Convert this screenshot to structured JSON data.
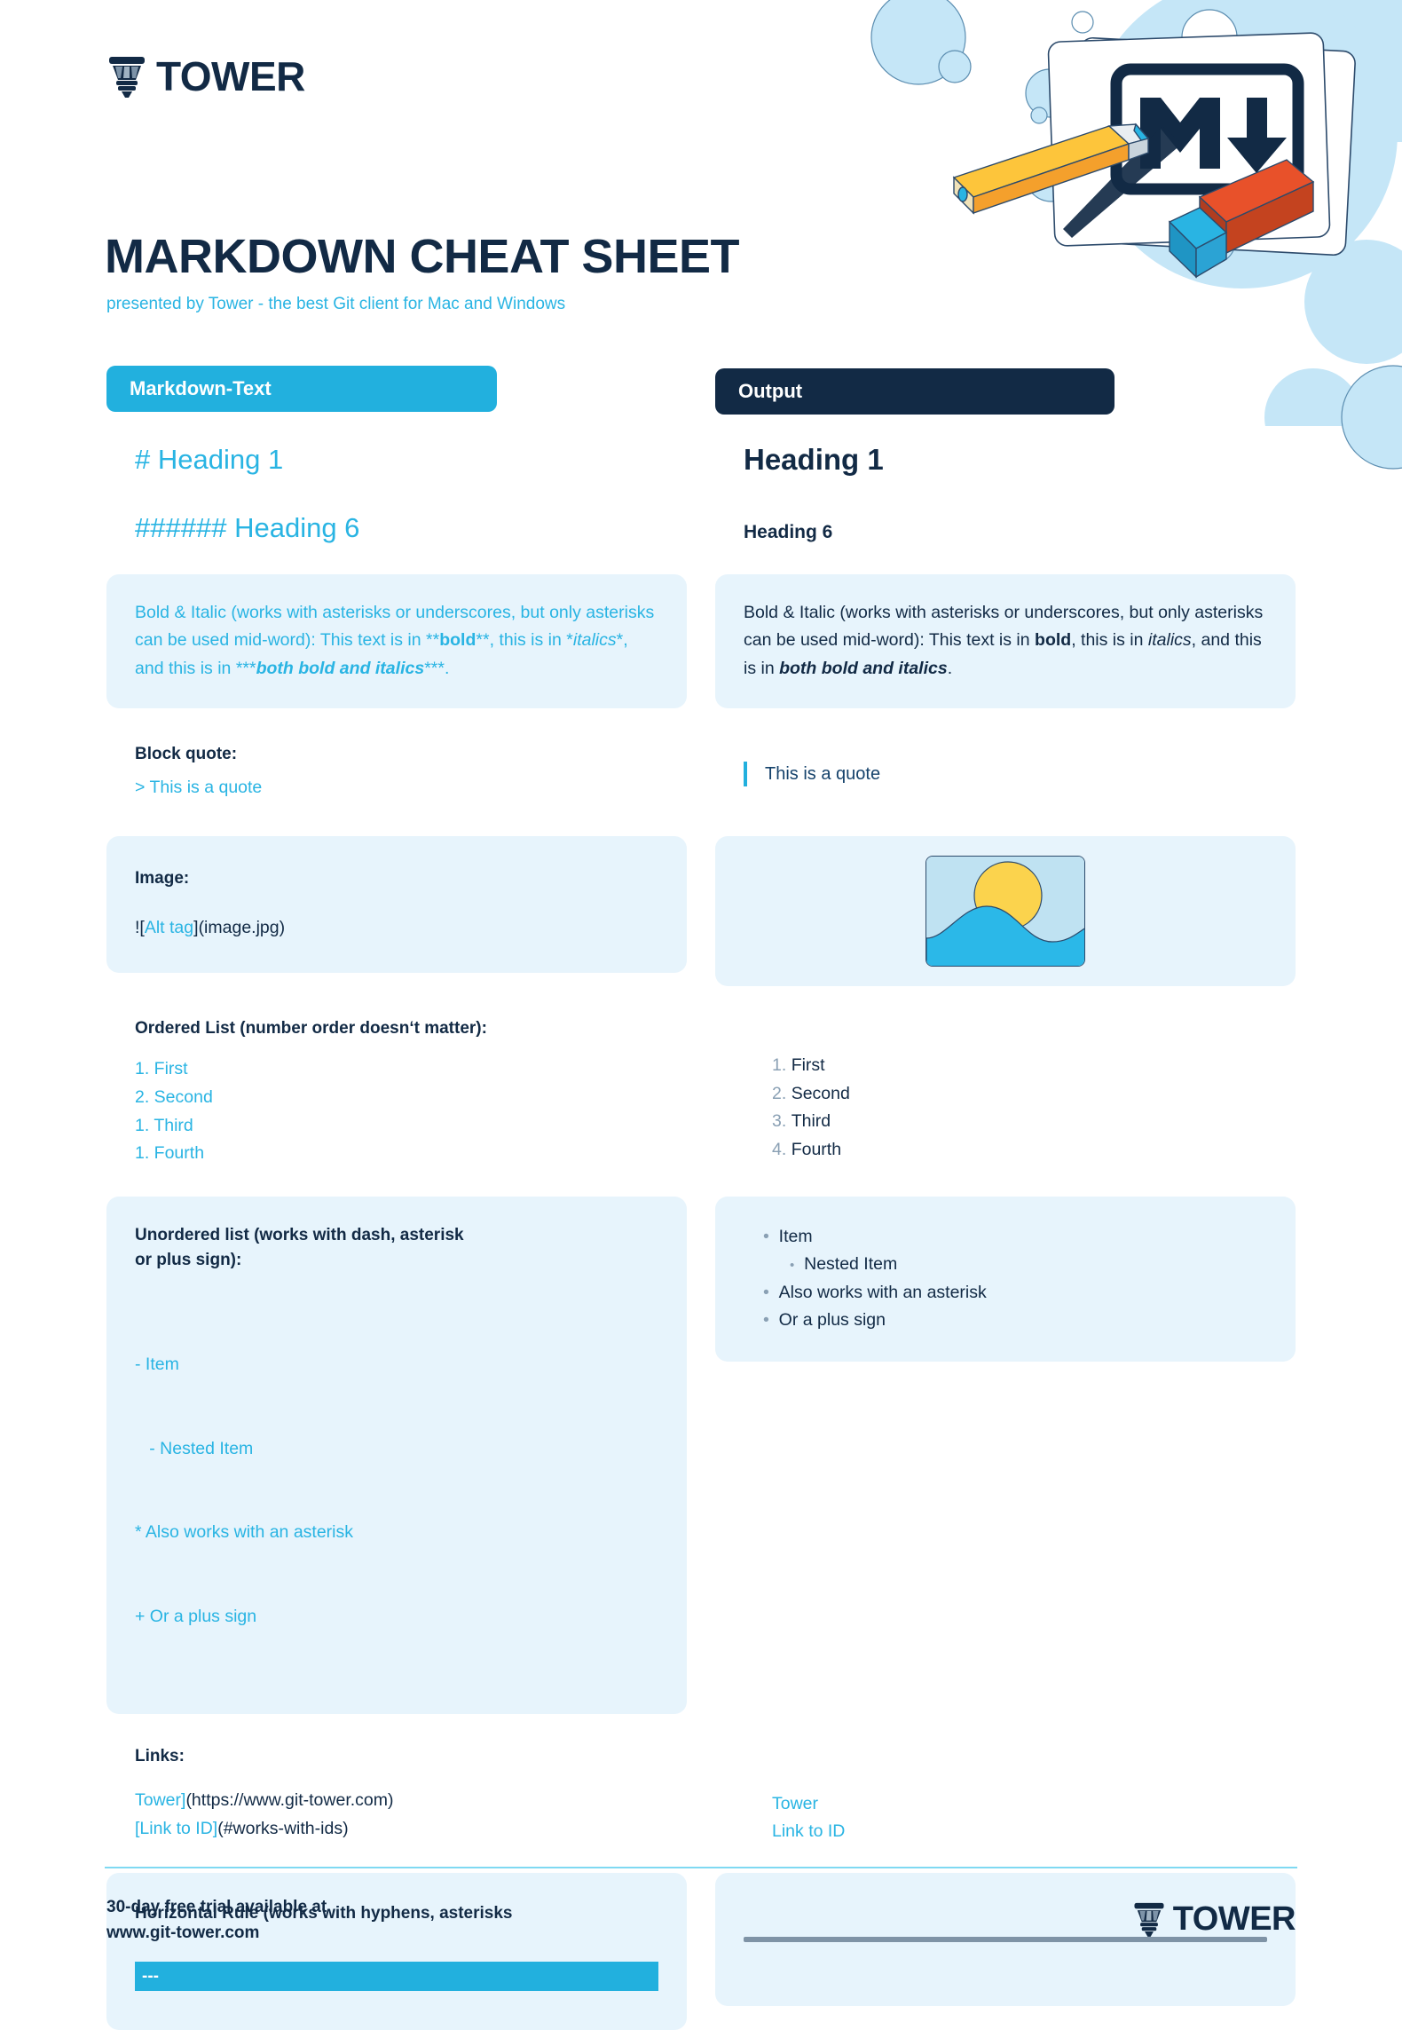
{
  "brand": {
    "name": "TOWER",
    "logo_icon": "tower-logo-icon"
  },
  "header": {
    "title": "MARKDOWN CHEAT SHEET",
    "subtitle": "presented by Tower - the best Git client for Mac and Windows"
  },
  "columns": {
    "markdown_label": "Markdown-Text",
    "output_label": "Output"
  },
  "decoration": {
    "markdown_mark": "M",
    "arrow": "↓"
  },
  "rows": {
    "heading1": {
      "md_hash": "#",
      "md_text": "Heading 1",
      "out_text": "Heading 1"
    },
    "heading6": {
      "md_hash": "######",
      "md_text": "Heading 6",
      "out_text": "Heading 6"
    },
    "bolditalic": {
      "md": {
        "p1": "Bold & Italic (works with asterisks or underscores, but only asterisks can be used mid-word): This text is in ",
        "stars2a": "**",
        "bold": "bold",
        "stars2b": "**",
        "p2": ", this is in ",
        "star1a": "*",
        "italic": "italics",
        "star1b": "*",
        "p3": ", and this is in ",
        "stars3a": "***",
        "bolditalic": "both bold and italics",
        "stars3b": "***",
        "p4": "."
      },
      "out": {
        "p1": "Bold & Italic (works with asterisks or underscores, but only asterisks can be used mid-word): This text is in ",
        "bold": "bold",
        "p2": ", this is in ",
        "italic": "italics",
        "p3": ", and this is in ",
        "bolditalic": "both bold and italics",
        "p4": "."
      }
    },
    "blockquote": {
      "label": "Block quote:",
      "md": "> This is a quote",
      "out": "This is a quote"
    },
    "image": {
      "label": "Image:",
      "md_bang": "!",
      "md_bracket_open": "[",
      "md_alt": "Alt tag",
      "md_bracket_close": "]",
      "md_path": "(image.jpg)",
      "out_alt": "landscape-image-placeholder"
    },
    "ordered_list": {
      "label": "Ordered List (number order doesn‘t matter):",
      "md_items": [
        "1. First",
        "2. Second",
        "1. Third",
        "1. Fourth"
      ],
      "out_items": [
        {
          "num": "1.",
          "text": "First"
        },
        {
          "num": "2.",
          "text": "Second"
        },
        {
          "num": "3.",
          "text": "Third"
        },
        {
          "num": "4.",
          "text": "Fourth"
        }
      ]
    },
    "unordered_list": {
      "label_line1": "Unordered list (works with dash, asterisk",
      "label_line2": "or plus sign):",
      "md_items": [
        "- Item",
        "   - Nested Item",
        "* Also works with an asterisk",
        "+ Or a plus sign"
      ],
      "out_items": [
        {
          "text": "Item",
          "nested": false
        },
        {
          "text": "Nested Item",
          "nested": true
        },
        {
          "text": "Also works with an asterisk",
          "nested": false
        },
        {
          "text": "Or a plus sign",
          "nested": false
        }
      ]
    },
    "links": {
      "label": "Links:",
      "md_line1_link": "Tower]",
      "md_line1_url": "(https://www.git-tower.com)",
      "md_line2_link": "[Link to ID]",
      "md_line2_url": "(#works-with-ids)",
      "out_line1": "Tower",
      "out_line2": "Link to ID"
    },
    "horizontal_rule": {
      "label": "Horizontal Rule (works with hyphens, asterisks",
      "md": "---"
    }
  },
  "footer": {
    "line1": "30-day free trial available at",
    "line2": "www.git-tower.com",
    "brand": "TOWER"
  },
  "colors": {
    "navy": "#122a45",
    "cyan": "#29b4e3",
    "card_bg": "#e7f4fc",
    "rule_gray": "#7f93a6"
  }
}
